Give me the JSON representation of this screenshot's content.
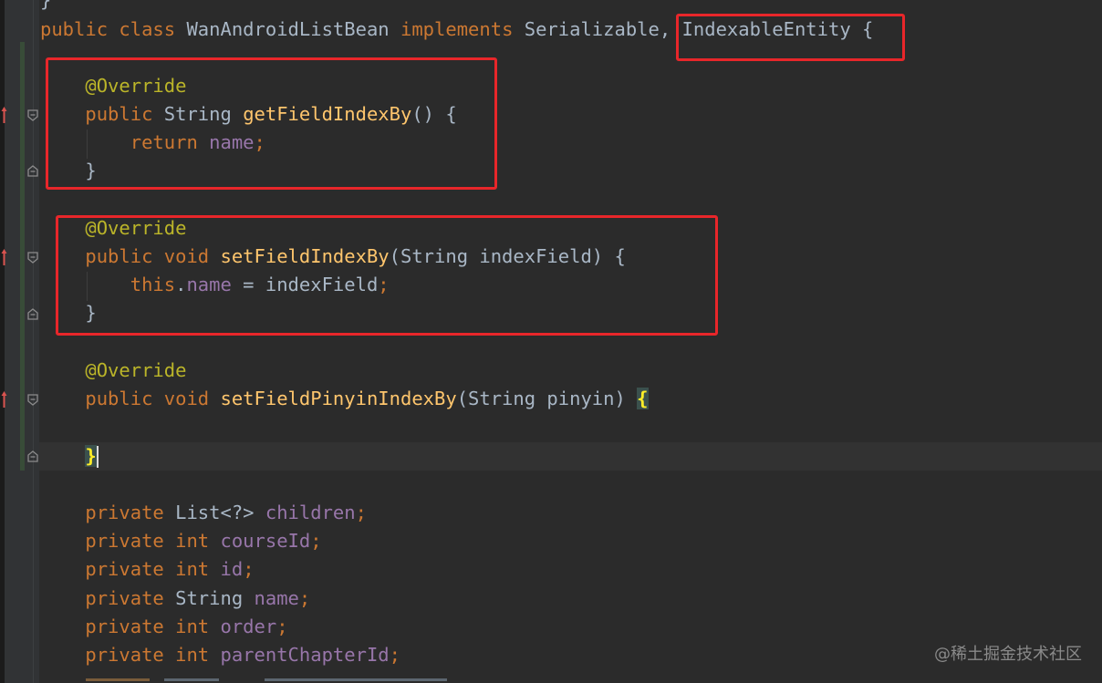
{
  "editor": {
    "top_partial": "}",
    "lines": {
      "class_decl": {
        "kw_public": "public",
        "kw_class": "class",
        "class_name": "WanAndroidListBean",
        "kw_implements": "implements",
        "iface1": "Serializable,",
        "iface2": "IndexableEntity {"
      },
      "m1_annotation": "@Override",
      "m1_sig": {
        "kw": "public",
        "type": "String",
        "name": "getFieldIndexBy",
        "rest": "() {"
      },
      "m1_body": {
        "kw": "return",
        "field": "name",
        "end": ";"
      },
      "m1_close": "}",
      "m2_annotation": "@Override",
      "m2_sig": {
        "kw1": "public",
        "kw2": "void",
        "name": "setFieldIndexBy",
        "rest": "(String indexField) {"
      },
      "m2_body": {
        "kw": "this",
        "dot": ".",
        "field": "name",
        "assign": " = indexField",
        "end": ";"
      },
      "m2_close": "}",
      "m3_annotation": "@Override",
      "m3_sig": {
        "kw1": "public",
        "kw2": "void",
        "name": "setFieldPinyinIndexBy",
        "rest": "(String pinyin) ",
        "brace": "{"
      },
      "m3_close": "}",
      "fields": [
        {
          "kw": "private",
          "type": "List<?>",
          "type_is_kw": false,
          "name": "children"
        },
        {
          "kw": "private",
          "type": "int",
          "type_is_kw": true,
          "name": "courseId"
        },
        {
          "kw": "private",
          "type": "int",
          "type_is_kw": true,
          "name": "id"
        },
        {
          "kw": "private",
          "type": "String",
          "type_is_kw": false,
          "name": "name"
        },
        {
          "kw": "private",
          "type": "int",
          "type_is_kw": true,
          "name": "order"
        },
        {
          "kw": "private",
          "type": "int",
          "type_is_kw": true,
          "name": "parentChapterId"
        }
      ]
    }
  },
  "watermark": "@稀土掘金技术社区",
  "colors": {
    "background": "#2b2b2b",
    "keyword": "#cc7832",
    "method": "#ffc66d",
    "field": "#9876aa",
    "annotation": "#bbb529",
    "text": "#a9b7c6",
    "highlight_box": "#e8262a"
  }
}
